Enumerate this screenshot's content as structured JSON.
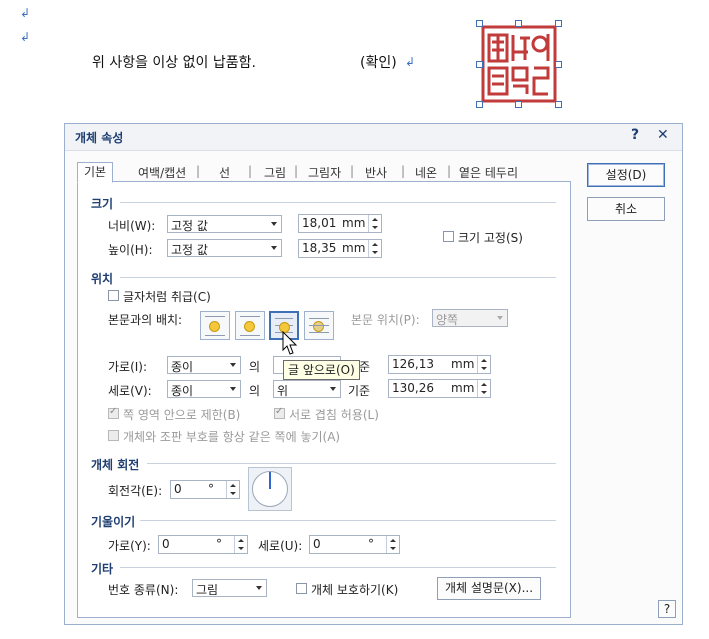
{
  "document": {
    "line_text": "위 사항을 이상 없이 납품함.",
    "confirm_text": "(확인)"
  },
  "dialog": {
    "title": "개체 속성",
    "help_label": "?",
    "close_label": "✕",
    "tabs": [
      "기본",
      "여백/캡션",
      "선",
      "그림",
      "그림자",
      "반사",
      "네온",
      "옅은 테두리"
    ],
    "buttons": {
      "ok": "설정(D)",
      "cancel": "취소"
    },
    "corner_help": "?"
  },
  "size": {
    "section": "크기",
    "width_label": "너비(W):",
    "width_mode": "고정 값",
    "width_value": "18,01",
    "height_label": "높이(H):",
    "height_mode": "고정 값",
    "height_value": "18,35",
    "unit": "mm",
    "lock_label": "크기 고정(S)"
  },
  "position": {
    "section": "위치",
    "treat_as_char_label": "글자처럼 취급(C)",
    "text_wrap_label": "본문과의 배치:",
    "body_pos_label": "본문 위치(P):",
    "body_pos_value": "양쪽",
    "horiz_label": "가로(I):",
    "horiz_ref": "종이",
    "horiz_of": "의",
    "horiz_base_label": "기준",
    "horiz_value": "126,13",
    "vert_label": "세로(V):",
    "vert_ref": "종이",
    "vert_of": "의",
    "vert_align": "위",
    "vert_base_label": "기준",
    "vert_value": "130,26",
    "unit": "mm",
    "limit_page_label": "쪽 영역 안으로 제한(B)",
    "overlap_label": "서로 겹침 허용(L)",
    "same_page_label": "개체와 조판 부호를 항상 같은 쪽에 놓기(A)",
    "tooltip": "글 앞으로(O)"
  },
  "rotation": {
    "section": "개체 회전",
    "angle_label": "회전각(E):",
    "angle_value": "0",
    "degree": "°"
  },
  "skew": {
    "section": "기울이기",
    "horiz_label": "가로(Y):",
    "horiz_value": "0",
    "vert_label": "세로(U):",
    "vert_value": "0",
    "degree": "°"
  },
  "other": {
    "section": "기타",
    "numbering_label": "번호 종류(N):",
    "numbering_value": "그림",
    "protect_label": "개체 보호하기(K)",
    "desc_button": "개체 설명문(X)..."
  },
  "colors": {
    "accent": "#3f6fb5",
    "title": "#1f3f73",
    "stamp": "#c23b3b"
  }
}
